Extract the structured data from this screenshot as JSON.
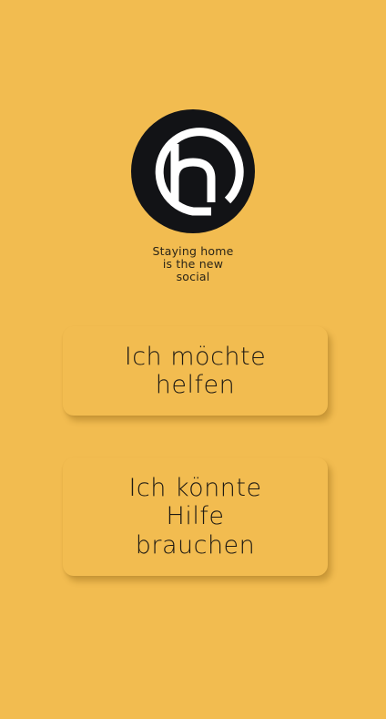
{
  "app": {
    "logo_icon": "at-h-logo-icon",
    "tagline_lines": [
      "Staying home",
      "is the new",
      "social"
    ]
  },
  "actions": [
    {
      "lines": [
        "Ich möchte",
        "helfen"
      ]
    },
    {
      "lines": [
        "Ich könnte",
        "Hilfe",
        "brauchen"
      ]
    }
  ],
  "colors": {
    "background": "#f2bc50",
    "logo_circle": "#121316",
    "logo_glyph": "#ffffff",
    "text": "#1e1a14"
  }
}
